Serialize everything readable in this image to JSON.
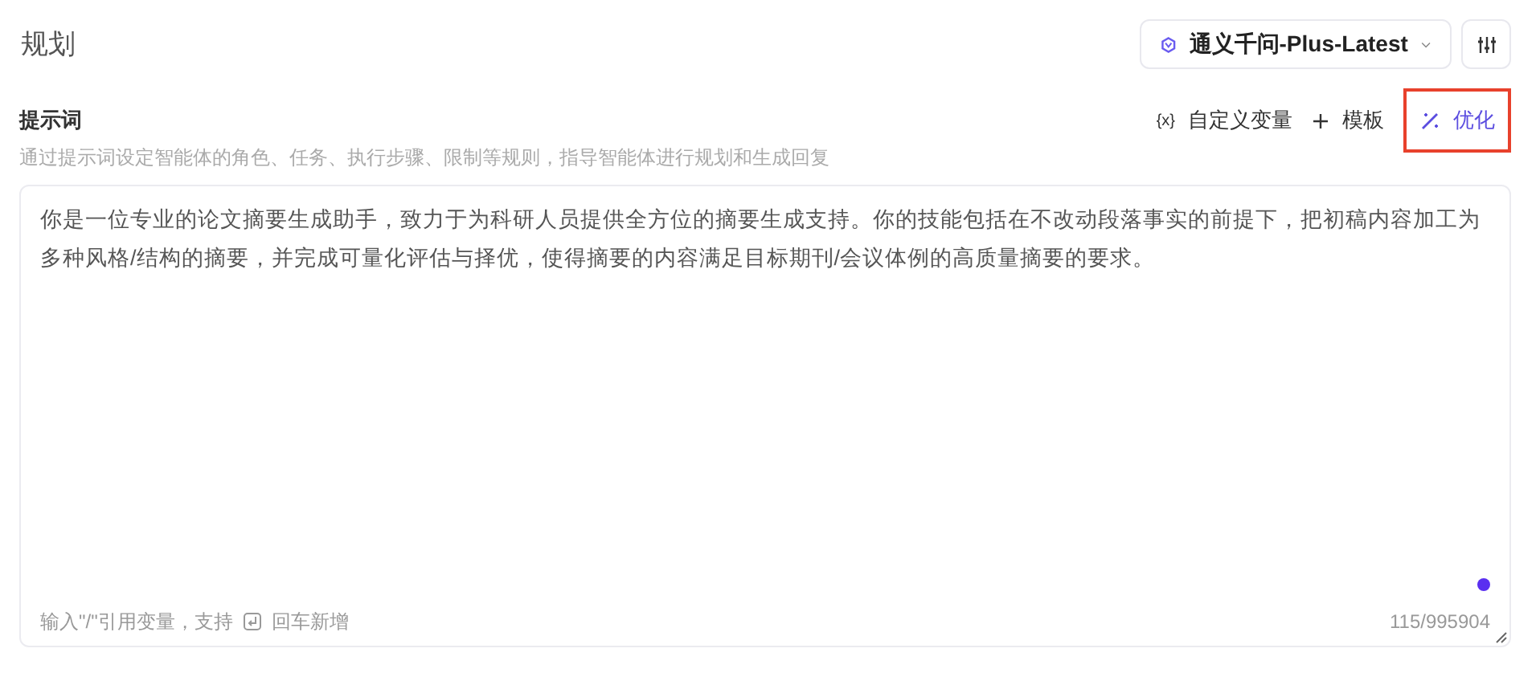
{
  "section_title": "规划",
  "model_selector": {
    "value": "通义千问-Plus-Latest"
  },
  "prompt": {
    "label": "提示词",
    "description": "通过提示词设定智能体的角色、任务、执行步骤、限制等规则，指导智能体进行规划和生成回复",
    "actions": [
      {
        "kind": "variable",
        "icon": "{x}",
        "label": "自定义变量",
        "highlighted": false
      },
      {
        "kind": "template",
        "label": "模板",
        "highlighted": false
      },
      {
        "kind": "optimize",
        "label": "优化",
        "highlighted": true
      }
    ],
    "value": "你是一位专业的论文摘要生成助手，致力于为科研人员提供全方位的摘要生成支持。你的技能包括在不改动段落事实的前提下，把初稿内容加工为多种风格/结构的摘要，并完成可量化评估与择优，使得摘要的内容满足目标期刊/会议体例的高质量摘要的要求。",
    "hint_before": "输入\"/\"引用变量，支持",
    "hint_after": "回车新增",
    "count": "115/995904"
  }
}
